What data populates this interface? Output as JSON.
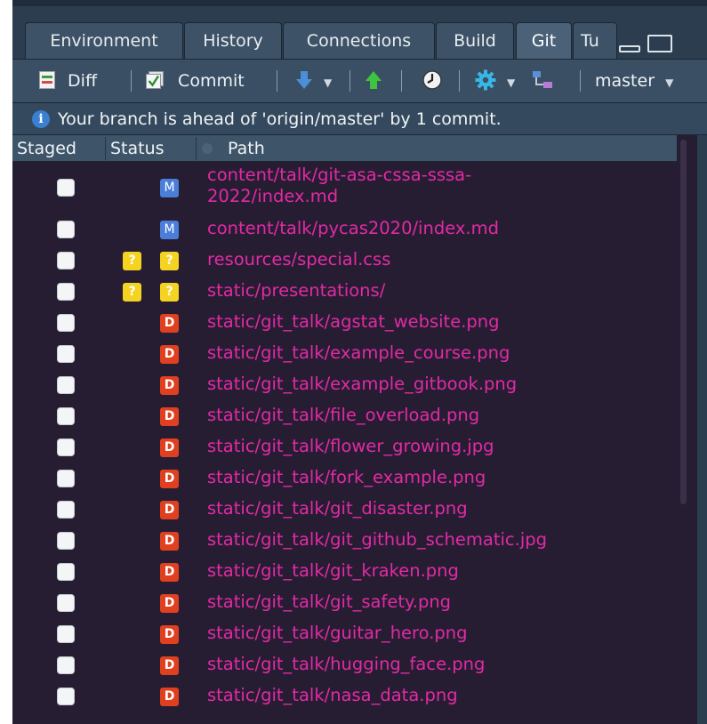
{
  "tabs": [
    {
      "label": "Environment",
      "active": false
    },
    {
      "label": "History",
      "active": false
    },
    {
      "label": "Connections",
      "active": false
    },
    {
      "label": "Build",
      "active": false
    },
    {
      "label": "Git",
      "active": true
    },
    {
      "label": "Tu",
      "active": false
    }
  ],
  "toolbar": {
    "diff_label": "Diff",
    "commit_label": "Commit",
    "pull_icon": "pull-arrow-down-icon",
    "push_icon": "push-arrow-up-icon",
    "history_icon": "clock-icon",
    "more_icon": "gear-icon",
    "branch_icon": "branch-icon",
    "branch_label": "master"
  },
  "info": {
    "icon": "info-icon",
    "text": "Your branch is ahead of 'origin/master' by 1 commit."
  },
  "columns": {
    "staged": "Staged",
    "status": "Status",
    "path": "Path"
  },
  "files": [
    {
      "staged": false,
      "status": [
        "M"
      ],
      "path_lines": [
        "content/talk/git-asa-cssa-sssa-",
        "2022/index.md"
      ]
    },
    {
      "staged": false,
      "status": [
        "M"
      ],
      "path_lines": [
        "content/talk/pycas2020/index.md"
      ]
    },
    {
      "staged": false,
      "status": [
        "?",
        "?"
      ],
      "path_lines": [
        "resources/special.css"
      ]
    },
    {
      "staged": false,
      "status": [
        "?",
        "?"
      ],
      "path_lines": [
        "static/presentations/"
      ]
    },
    {
      "staged": false,
      "status": [
        "D"
      ],
      "path_lines": [
        "static/git_talk/agstat_website.png"
      ]
    },
    {
      "staged": false,
      "status": [
        "D"
      ],
      "path_lines": [
        "static/git_talk/example_course.png"
      ]
    },
    {
      "staged": false,
      "status": [
        "D"
      ],
      "path_lines": [
        "static/git_talk/example_gitbook.png"
      ]
    },
    {
      "staged": false,
      "status": [
        "D"
      ],
      "path_lines": [
        "static/git_talk/file_overload.png"
      ]
    },
    {
      "staged": false,
      "status": [
        "D"
      ],
      "path_lines": [
        "static/git_talk/flower_growing.jpg"
      ]
    },
    {
      "staged": false,
      "status": [
        "D"
      ],
      "path_lines": [
        "static/git_talk/fork_example.png"
      ]
    },
    {
      "staged": false,
      "status": [
        "D"
      ],
      "path_lines": [
        "static/git_talk/git_disaster.png"
      ]
    },
    {
      "staged": false,
      "status": [
        "D"
      ],
      "path_lines": [
        "static/git_talk/git_github_schematic.jpg"
      ]
    },
    {
      "staged": false,
      "status": [
        "D"
      ],
      "path_lines": [
        "static/git_talk/git_kraken.png"
      ]
    },
    {
      "staged": false,
      "status": [
        "D"
      ],
      "path_lines": [
        "static/git_talk/git_safety.png"
      ]
    },
    {
      "staged": false,
      "status": [
        "D"
      ],
      "path_lines": [
        "static/git_talk/guitar_hero.png"
      ]
    },
    {
      "staged": false,
      "status": [
        "D"
      ],
      "path_lines": [
        "static/git_talk/hugging_face.png"
      ]
    },
    {
      "staged": false,
      "status": [
        "D"
      ],
      "path_lines": [
        "static/git_talk/nasa_data.png"
      ]
    }
  ],
  "colors": {
    "path_text": "#e22aa4",
    "list_bg": "#261d33",
    "modified": "#4a7ed8",
    "deleted": "#e0401f",
    "untracked": "#f5d321"
  }
}
